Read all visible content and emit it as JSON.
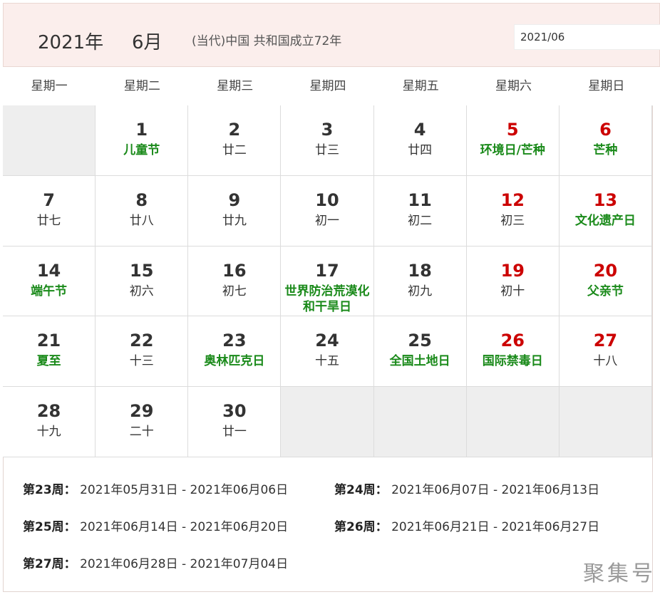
{
  "header": {
    "year": "2021年",
    "month": "6月",
    "era": "(当代)中国 共和国成立72年",
    "date_value": "2021/06"
  },
  "weekdays": [
    "星期一",
    "星期二",
    "星期三",
    "星期四",
    "星期五",
    "星期六",
    "星期日"
  ],
  "days": [
    {
      "num": "1",
      "sub": "儿童节"
    },
    {
      "num": "2",
      "sub": "廿二"
    },
    {
      "num": "3",
      "sub": "廿三"
    },
    {
      "num": "4",
      "sub": "廿四"
    },
    {
      "num": "5",
      "sub": "环境日/芒种"
    },
    {
      "num": "6",
      "sub": "芒种"
    },
    {
      "num": "7",
      "sub": "廿七"
    },
    {
      "num": "8",
      "sub": "廿八"
    },
    {
      "num": "9",
      "sub": "廿九"
    },
    {
      "num": "10",
      "sub": "初一"
    },
    {
      "num": "11",
      "sub": "初二"
    },
    {
      "num": "12",
      "sub": "初三"
    },
    {
      "num": "13",
      "sub": "文化遗产日"
    },
    {
      "num": "14",
      "sub": "端午节"
    },
    {
      "num": "15",
      "sub": "初六"
    },
    {
      "num": "16",
      "sub": "初七"
    },
    {
      "num": "17",
      "sub": "世界防治荒漠化和干旱日"
    },
    {
      "num": "18",
      "sub": "初九"
    },
    {
      "num": "19",
      "sub": "初十"
    },
    {
      "num": "20",
      "sub": "父亲节"
    },
    {
      "num": "21",
      "sub": "夏至"
    },
    {
      "num": "22",
      "sub": "十三"
    },
    {
      "num": "23",
      "sub": "奥林匹克日"
    },
    {
      "num": "24",
      "sub": "十五"
    },
    {
      "num": "25",
      "sub": "全国土地日"
    },
    {
      "num": "26",
      "sub": "国际禁毒日"
    },
    {
      "num": "27",
      "sub": "十八"
    },
    {
      "num": "28",
      "sub": "十九"
    },
    {
      "num": "29",
      "sub": "二十"
    },
    {
      "num": "30",
      "sub": "廿一"
    }
  ],
  "weeks": [
    {
      "label": "第23周：",
      "range": "2021年05月31日 - 2021年06月06日"
    },
    {
      "label": "第24周：",
      "range": "2021年06月07日 - 2021年06月13日"
    },
    {
      "label": "第25周：",
      "range": "2021年06月14日 - 2021年06月20日"
    },
    {
      "label": "第26周：",
      "range": "2021年06月21日 - 2021年06月27日"
    },
    {
      "label": "第27周：",
      "range": "2021年06月28日 - 2021年07月04日"
    }
  ],
  "watermark": "聚集号",
  "colors": {
    "weekend": "#cc0000",
    "festival": "#1a8a1a",
    "header_bg": "#fbeeec",
    "empty_cell": "#eeeeee"
  }
}
